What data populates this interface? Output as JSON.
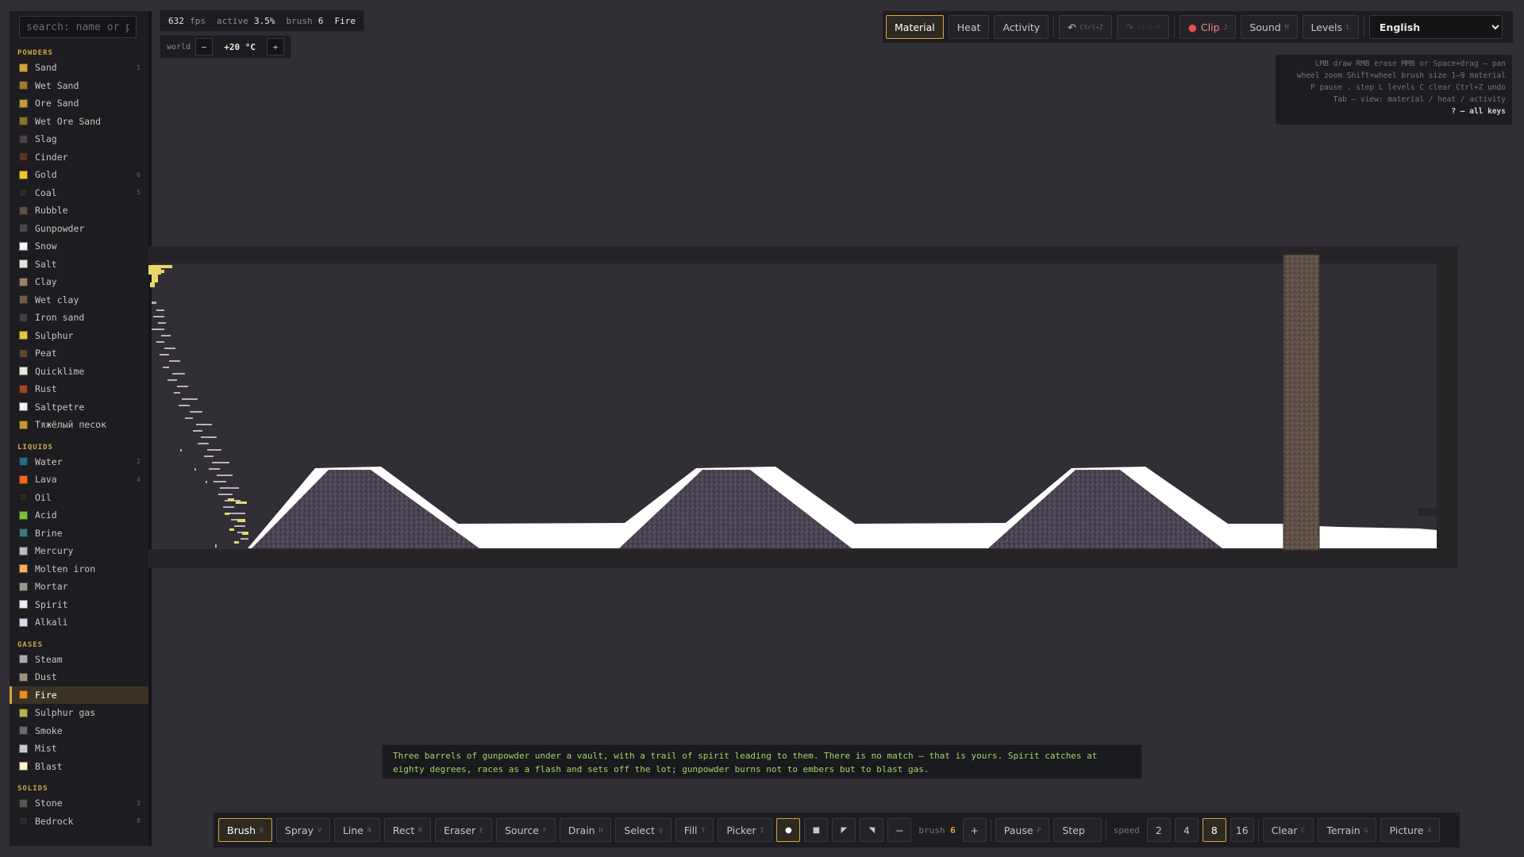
{
  "search": {
    "placeholder": "search: name or prope"
  },
  "sidebar": {
    "categories": [
      {
        "title": "POWDERS",
        "items": [
          {
            "name": "Sand",
            "key": "1",
            "color": "#d4a43c"
          },
          {
            "name": "Wet Sand",
            "key": "",
            "color": "#9c7a2e"
          },
          {
            "name": "Ore Sand",
            "key": "",
            "color": "#c29a3a"
          },
          {
            "name": "Wet Ore Sand",
            "key": "",
            "color": "#8e6e2c"
          },
          {
            "name": "Slag",
            "key": "",
            "color": "#4e3f4e"
          },
          {
            "name": "Cinder",
            "key": "",
            "color": "#5a3428"
          },
          {
            "name": "Gold",
            "key": "6",
            "color": "#f2c531"
          },
          {
            "name": "Coal",
            "key": "5",
            "color": "#2a2a2a"
          },
          {
            "name": "Rubble",
            "key": "",
            "color": "#5e5046"
          },
          {
            "name": "Gunpowder",
            "key": "",
            "color": "#4b4352"
          },
          {
            "name": "Snow",
            "key": "",
            "color": "#f4f6fa"
          },
          {
            "name": "Salt",
            "key": "",
            "color": "#e6e2dc"
          },
          {
            "name": "Clay",
            "key": "",
            "color": "#9a7e68"
          },
          {
            "name": "Wet clay",
            "key": "",
            "color": "#6e5a48"
          },
          {
            "name": "Iron sand",
            "key": "",
            "color": "#3e4046"
          },
          {
            "name": "Sulphur",
            "key": "",
            "color": "#e0c93a"
          },
          {
            "name": "Peat",
            "key": "",
            "color": "#5c4632"
          },
          {
            "name": "Quicklime",
            "key": "",
            "color": "#eae6de"
          },
          {
            "name": "Rust",
            "key": "",
            "color": "#9a4a24"
          },
          {
            "name": "Saltpetre",
            "key": "",
            "color": "#f2f2f0"
          },
          {
            "name": "Тяжёлый песок",
            "key": "",
            "color": "#c89a32"
          }
        ]
      },
      {
        "title": "LIQUIDS",
        "items": [
          {
            "name": "Water",
            "key": "2",
            "color": "#2a6a8a"
          },
          {
            "name": "Lava",
            "key": "4",
            "color": "#f26a22"
          },
          {
            "name": "Oil",
            "key": "",
            "color": "#2a2620"
          },
          {
            "name": "Acid",
            "key": "",
            "color": "#7ac23a"
          },
          {
            "name": "Brine",
            "key": "",
            "color": "#3a7a7a"
          },
          {
            "name": "Mercury",
            "key": "",
            "color": "#b8bcc2"
          },
          {
            "name": "Molten iron",
            "key": "",
            "color": "#f2b05a"
          },
          {
            "name": "Mortar",
            "key": "",
            "color": "#9a968e"
          },
          {
            "name": "Spirit",
            "key": "",
            "color": "#e8eef6"
          },
          {
            "name": "Alkali",
            "key": "",
            "color": "#dcd6ec"
          }
        ]
      },
      {
        "title": "GASES",
        "items": [
          {
            "name": "Steam",
            "key": "",
            "color": "#a8aab0"
          },
          {
            "name": "Dust",
            "key": "",
            "color": "#a0907a"
          },
          {
            "name": "Fire",
            "key": "",
            "color": "#f28a22",
            "selected": true
          },
          {
            "name": "Sulphur gas",
            "key": "",
            "color": "#b8b04a"
          },
          {
            "name": "Smoke",
            "key": "",
            "color": "#6a686c"
          },
          {
            "name": "Mist",
            "key": "",
            "color": "#c8ccd2"
          },
          {
            "name": "Blast",
            "key": "",
            "color": "#fff2c8"
          }
        ]
      },
      {
        "title": "SOLIDS",
        "items": [
          {
            "name": "Stone",
            "key": "3",
            "color": "#5a5452"
          },
          {
            "name": "Bedrock",
            "key": "8",
            "color": "#2a2a2a"
          }
        ]
      }
    ]
  },
  "stats": {
    "fps_value": "632",
    "fps_label": "fps",
    "active_label": "active",
    "active_value": "3.5%",
    "brush_label": "brush",
    "brush_value": "6",
    "material": "Fire"
  },
  "world": {
    "label": "world",
    "minus": "−",
    "temperature": "+20 °C",
    "plus": "+"
  },
  "topbar": {
    "views": [
      {
        "label": "Material",
        "active": true
      },
      {
        "label": "Heat",
        "active": false
      },
      {
        "label": "Activity",
        "active": false
      }
    ],
    "undo": {
      "icon": "↶",
      "key": "Ctrl+Z"
    },
    "redo": {
      "icon": "↷",
      "key": "Ctrl+Y"
    },
    "clip": {
      "dot": "●",
      "label": "Clip",
      "key": "J"
    },
    "sound": {
      "label": "Sound",
      "key": "M"
    },
    "levels": {
      "label": "Levels",
      "key": "L"
    },
    "language": "English"
  },
  "help": {
    "lines": [
      "LMB draw   RMB erase   MMB or Space+drag — pan",
      "wheel zoom   Shift+wheel brush size   1–9 material",
      "P pause   . step   L levels   C clear   Ctrl+Z undo",
      "Tab — view: material / heat / activity"
    ],
    "all_keys": "? — all keys"
  },
  "hint": {
    "text": "Three barrels of gunpowder under a vault, with a trail of spirit leading to them. There is no match — that is yours. Spirit catches at eighty degrees, races as a flash and sets off the lot; gunpowder burns not to embers but to blast gas."
  },
  "bottombar": {
    "tools": [
      {
        "label": "Brush",
        "key": "B",
        "active": true
      },
      {
        "label": "Spray",
        "key": "V",
        "active": false
      },
      {
        "label": "Line",
        "key": "N",
        "active": false
      },
      {
        "label": "Rect",
        "key": "R",
        "active": false
      },
      {
        "label": "Eraser",
        "key": "E",
        "active": false
      },
      {
        "label": "Source",
        "key": "F",
        "active": false
      },
      {
        "label": "Drain",
        "key": "H",
        "active": false
      },
      {
        "label": "Select",
        "key": "Q",
        "active": false
      },
      {
        "label": "Fill",
        "key": "T",
        "active": false
      },
      {
        "label": "Picker",
        "key": "I",
        "active": false
      }
    ],
    "shapes": [
      {
        "icon": "●",
        "name": "shape-circle",
        "active": true
      },
      {
        "icon": "■",
        "name": "shape-square",
        "active": false
      },
      {
        "icon": "◤",
        "name": "shape-triangle-left",
        "active": false
      },
      {
        "icon": "◥",
        "name": "shape-triangle-right",
        "active": false
      }
    ],
    "brush": {
      "minus": "−",
      "label": "brush",
      "value": "6",
      "plus": "+"
    },
    "pause": {
      "label": "Pause",
      "key": "P"
    },
    "step": {
      "label": "Step",
      "key": "."
    },
    "speed": {
      "label": "speed",
      "values": [
        "2",
        "4",
        "8",
        "16"
      ],
      "selected": "8"
    },
    "clear": {
      "label": "Clear",
      "key": "C"
    },
    "terrain": {
      "label": "Terrain",
      "key": "G"
    },
    "picture": {
      "label": "Picture",
      "key": "X"
    }
  },
  "colors": {
    "accent": "#d9a441",
    "hint_text": "#9fd66b",
    "bg": "#312e35",
    "panel": "#1d1c20"
  }
}
